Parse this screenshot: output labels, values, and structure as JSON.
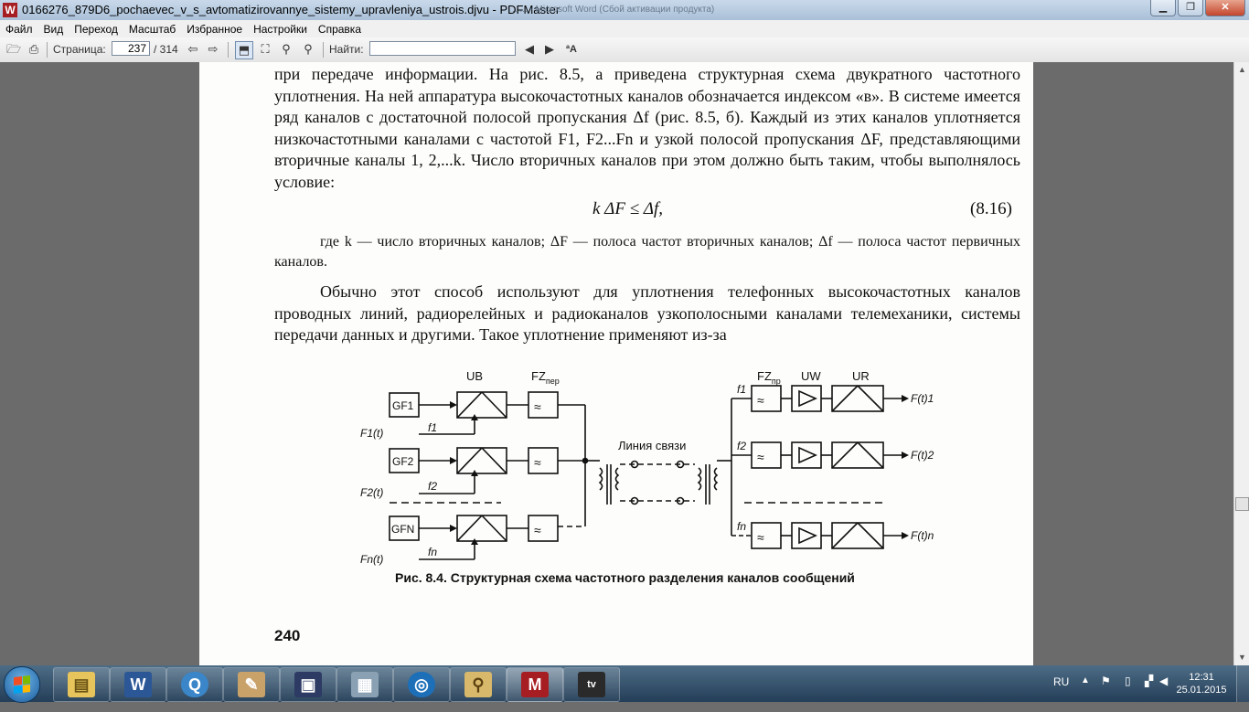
{
  "window": {
    "title": "0166276_879D6_pochaevec_v_s_avtomatizirovannye_sistemy_upravleniya_ustrois.djvu - PDFMaster",
    "app_icon": "W",
    "ghost_text": "...... - Microsoft Word (Сбой активации продукта)"
  },
  "menu": [
    "Файл",
    "Вид",
    "Переход",
    "Масштаб",
    "Избранное",
    "Настройки",
    "Справка"
  ],
  "toolbar": {
    "page_label": "Страница:",
    "page_current": "237",
    "page_total": "/ 314",
    "find_label": "Найти:",
    "find_value": "",
    "font_toggle": "ªA"
  },
  "document": {
    "para1": "при передаче информации. На рис. 8.5, а приведена структурная схема двукратного частотного уплотнения. На ней аппаратура высокочастотных каналов обозначается индексом «в». В системе имеется ряд каналов с достаточной полосой пропускания Δf (рис. 8.5, б). Каждый из этих каналов уплотняется низкочастотными каналами с частотой F1, F2...Fn и узкой полосой пропускания ΔF, представляющими вторичные каналы 1, 2,...k. Число вторичных каналов при этом должно быть таким, чтобы выполнялось условие:",
    "formula": "k ΔF ≤ Δf,",
    "formula_number": "(8.16)",
    "para2": "где k — число вторичных каналов; ΔF — полоса частот вторичных каналов; Δf — полоса частот первичных каналов.",
    "para3": "Обычно этот способ используют для уплотнения телефонных высокочастотных каналов проводных линий, радиорелейных и радиоканалов узкополосными каналами телемеханики, системы передачи данных и другими. Такое уплотнение применяют из-за",
    "caption": "Рис. 8.4. Структурная схема частотного разделения каналов сообщений",
    "page_number": "240"
  },
  "diagram": {
    "label_ub": "UB",
    "label_fz_per": "FZ",
    "label_fz_per_sub": "пер",
    "label_fz_pr": "FZ",
    "label_fz_pr_sub": "пр",
    "label_uw": "UW",
    "label_ur": "UR",
    "label_line": "Линия связи",
    "gen1": "GF1",
    "gen2": "GF2",
    "genN": "GFN",
    "in1": "F1(t)",
    "in2": "F2(t)",
    "inN": "Fn(t)",
    "f1": "f1",
    "f2": "f2",
    "fn": "fn",
    "out1": "F(t)1",
    "out2": "F(t)2",
    "outN": "F(t)n"
  },
  "taskbar": {
    "language": "RU",
    "time": "12:31",
    "date": "25.01.2015",
    "apps": [
      "explorer",
      "word",
      "quicktime",
      "paint",
      "save",
      "calculator",
      "browser",
      "search",
      "pdfmaster",
      "tv"
    ]
  }
}
